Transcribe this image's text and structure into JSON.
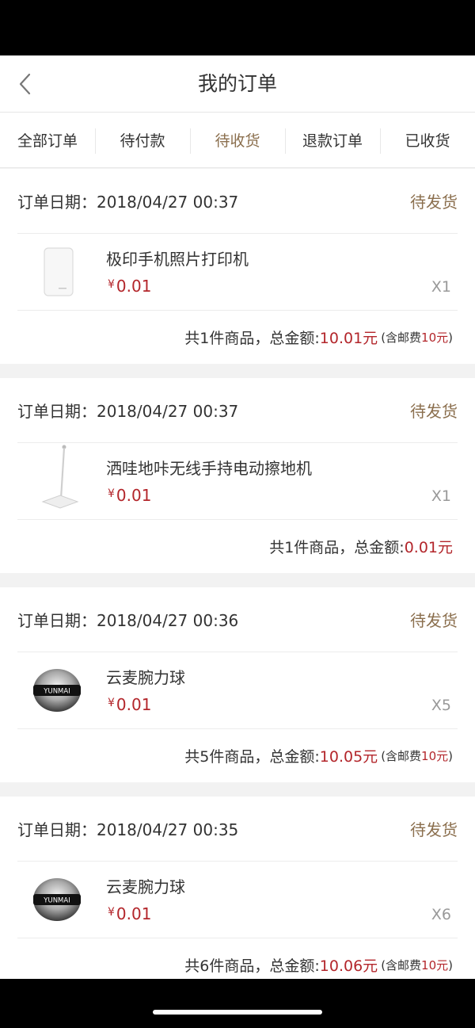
{
  "header": {
    "title": "我的订单",
    "back_icon": "chevron-left-icon"
  },
  "tabs": [
    {
      "label": "全部订单",
      "active": false
    },
    {
      "label": "待付款",
      "active": false
    },
    {
      "label": "待收货",
      "active": true
    },
    {
      "label": "退款订单",
      "active": false
    },
    {
      "label": "已收货",
      "active": false
    }
  ],
  "colors": {
    "accent": "#8b6f4e",
    "price": "#b3262b",
    "background": "#f2f2f2"
  },
  "orders": [
    {
      "date": "订单日期：2018/04/27 00:37",
      "status": "待发货",
      "item": {
        "name": "极印手机照片打印机",
        "currency": "¥",
        "price": "0.01",
        "qty": "X1",
        "thumb": "photo-printer-thumbnail"
      },
      "summary": {
        "text": "共1件商品，总金额: ",
        "amount": "10.01元",
        "ship_prefix": "(含邮费",
        "ship_fee": "10元",
        "ship_suffix": ")"
      }
    },
    {
      "date": "订单日期：2018/04/27 00:37",
      "status": "待发货",
      "item": {
        "name": "洒哇地咔无线手持电动擦地机",
        "currency": "¥",
        "price": "0.01",
        "qty": "X1",
        "thumb": "mop-thumbnail"
      },
      "summary": {
        "text": "共1件商品，总金额: ",
        "amount": "0.01元"
      }
    },
    {
      "date": "订单日期：2018/04/27 00:36",
      "status": "待发货",
      "item": {
        "name": "云麦腕力球",
        "currency": "¥",
        "price": "0.01",
        "qty": "X5",
        "thumb": "wrist-ball-thumbnail",
        "brand": "YUNMAI"
      },
      "summary": {
        "text": "共5件商品，总金额: ",
        "amount": "10.05元",
        "ship_prefix": "(含邮费",
        "ship_fee": "10元",
        "ship_suffix": ")"
      }
    },
    {
      "date": "订单日期：2018/04/27 00:35",
      "status": "待发货",
      "item": {
        "name": "云麦腕力球",
        "currency": "¥",
        "price": "0.01",
        "qty": "X6",
        "thumb": "wrist-ball-thumbnail",
        "brand": "YUNMAI"
      },
      "summary": {
        "text": "共6件商品，总金额: ",
        "amount": "10.06元",
        "ship_prefix": "(含邮费",
        "ship_fee": "10元",
        "ship_suffix": ")"
      }
    }
  ]
}
